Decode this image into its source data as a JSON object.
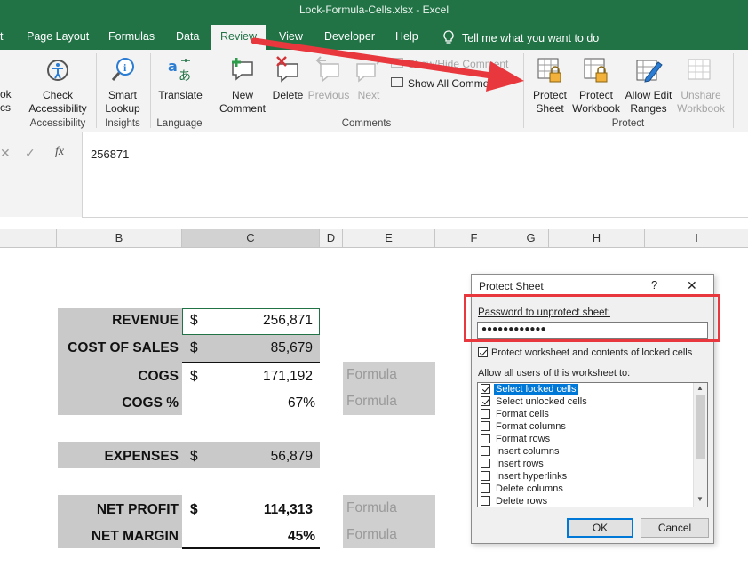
{
  "window": {
    "title": "Lock-Formula-Cells.xlsx  -  Excel"
  },
  "tabs": [
    {
      "label": "t"
    },
    {
      "label": "Page Layout"
    },
    {
      "label": "Formulas"
    },
    {
      "label": "Data"
    },
    {
      "label": "Review"
    },
    {
      "label": "View"
    },
    {
      "label": "Developer"
    },
    {
      "label": "Help"
    }
  ],
  "tell_me": "Tell me what you want to do",
  "ribbon": {
    "left_cut": [
      "ok",
      "cs"
    ],
    "accessibility": {
      "label1": "Check",
      "label2": "Accessibility",
      "group": "Accessibility"
    },
    "insights": {
      "label1": "Smart",
      "label2": "Lookup",
      "group": "Insights"
    },
    "language": {
      "label1": "Translate",
      "group": "Language"
    },
    "comments": {
      "new1": "New",
      "new2": "Comment",
      "delete": "Delete",
      "previous": "Previous",
      "next": "Next",
      "show_hide": "Show/Hide Comment",
      "show_all": "Show All Comments",
      "group": "Comments"
    },
    "protect": {
      "sheet1": "Protect",
      "sheet2": "Sheet",
      "workbook1": "Protect",
      "workbook2": "Workbook",
      "allow1": "Allow Edit",
      "allow2": "Ranges",
      "unshare1": "Unshare",
      "unshare2": "Workbook",
      "group": "Protect"
    }
  },
  "formula_bar": {
    "value": "256871",
    "fx": "fx"
  },
  "columns": [
    "B",
    "C",
    "D",
    "E",
    "F",
    "G",
    "H",
    "I"
  ],
  "sheet": {
    "revenue": {
      "label": "REVENUE",
      "cur": "$",
      "value": "256,871"
    },
    "cost_of_sales": {
      "label": "COST OF SALES",
      "cur": "$",
      "value": "85,679"
    },
    "cogs": {
      "label": "COGS",
      "cur": "$",
      "value": "171,192"
    },
    "cogs_pct": {
      "label": "COGS %",
      "value": "67%"
    },
    "expenses": {
      "label": "EXPENSES",
      "cur": "$",
      "value": "56,879"
    },
    "net_profit": {
      "label": "NET PROFIT",
      "cur": "$",
      "value": "114,313"
    },
    "net_margin": {
      "label": "NET MARGIN",
      "value": "45%"
    },
    "formula_text": "Formula"
  },
  "dialog": {
    "title": "Protect Sheet",
    "help": "?",
    "close": "✕",
    "password_label": "Password to unprotect sheet:",
    "password_value": "●●●●●●●●●●●●",
    "protect_contents": "Protect worksheet and contents of locked cells",
    "allow_label": "Allow all users of this worksheet to:",
    "permissions": [
      {
        "label": "Select locked cells",
        "checked": true
      },
      {
        "label": "Select unlocked cells",
        "checked": true
      },
      {
        "label": "Format cells",
        "checked": false
      },
      {
        "label": "Format columns",
        "checked": false
      },
      {
        "label": "Format rows",
        "checked": false
      },
      {
        "label": "Insert columns",
        "checked": false
      },
      {
        "label": "Insert rows",
        "checked": false
      },
      {
        "label": "Insert hyperlinks",
        "checked": false
      },
      {
        "label": "Delete columns",
        "checked": false
      },
      {
        "label": "Delete rows",
        "checked": false
      }
    ],
    "ok": "OK",
    "cancel": "Cancel"
  },
  "colors": {
    "excel_green": "#217346",
    "highlight_red": "#e8383d",
    "selection_blue": "#0078d7"
  }
}
